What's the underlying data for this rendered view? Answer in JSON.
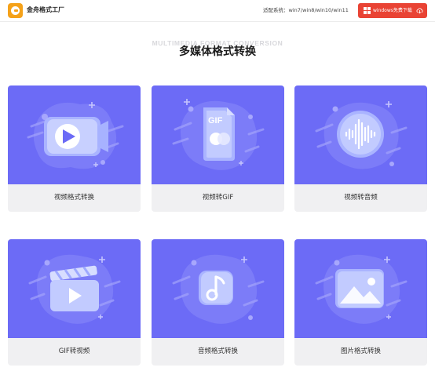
{
  "header": {
    "brand": "金舟格式工厂",
    "compat_text": "适配系统：win7/win8/win10/win11",
    "download_label": "windows免费下载"
  },
  "section": {
    "subtitle_en": "MULTIMEDIA FORMAT CONVERSION",
    "title": "多媒体格式转换"
  },
  "cards": [
    {
      "label": "视频格式转换",
      "icon": "video-camera-icon"
    },
    {
      "label": "视频转GIF",
      "icon": "gif-file-icon",
      "badge": "GIF"
    },
    {
      "label": "视频转音频",
      "icon": "audio-wave-icon"
    },
    {
      "label": "GIF转视频",
      "icon": "clapperboard-icon"
    },
    {
      "label": "音频格式转换",
      "icon": "music-note-icon"
    },
    {
      "label": "图片格式转换",
      "icon": "image-icon"
    }
  ],
  "colors": {
    "card_art": "#6c6bf6",
    "download_button": "#e94334",
    "logo": "#f5a21a"
  }
}
